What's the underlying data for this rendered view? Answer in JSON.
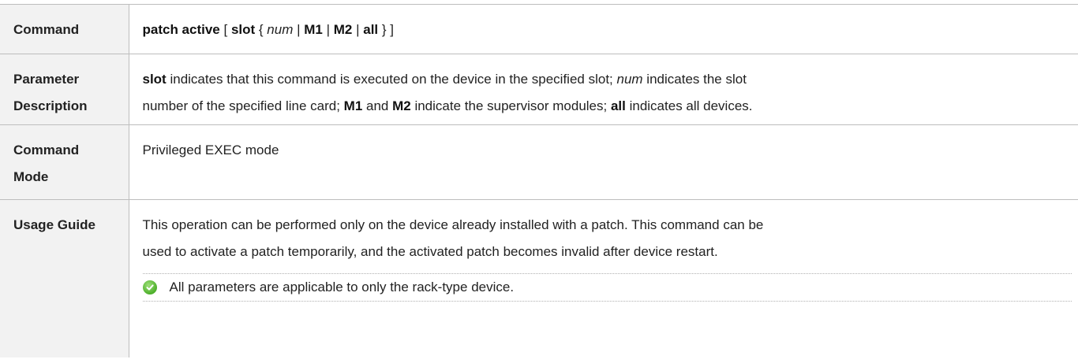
{
  "rows": {
    "command": {
      "label": "Command",
      "parts": [
        "patch active",
        " [ ",
        "slot",
        " { ",
        "num",
        " | ",
        "M1",
        " | ",
        "M2",
        " | ",
        "all",
        " } ]"
      ]
    },
    "parameter": {
      "label_line1": "Parameter",
      "label_line2": "Description",
      "line1": [
        "slot",
        " indicates that this command is executed on the device in the specified slot; ",
        "num",
        " indicates the slot"
      ],
      "line2": [
        "number of the specified line card; ",
        "M1",
        " and ",
        "M2",
        " indicate the supervisor modules; ",
        "all",
        " indicates all devices."
      ]
    },
    "mode": {
      "label_line1": "Command",
      "label_line2": "Mode",
      "value": "Privileged EXEC mode"
    },
    "usage": {
      "label": "Usage Guide",
      "line1": "This operation can be performed only on the device already installed with a patch. This command can be",
      "line2": "used to activate a patch temporarily, and the activated patch becomes invalid after device restart.",
      "note": "All parameters are applicable to only the rack-type device.",
      "note_icon": "check-circle-icon"
    }
  }
}
